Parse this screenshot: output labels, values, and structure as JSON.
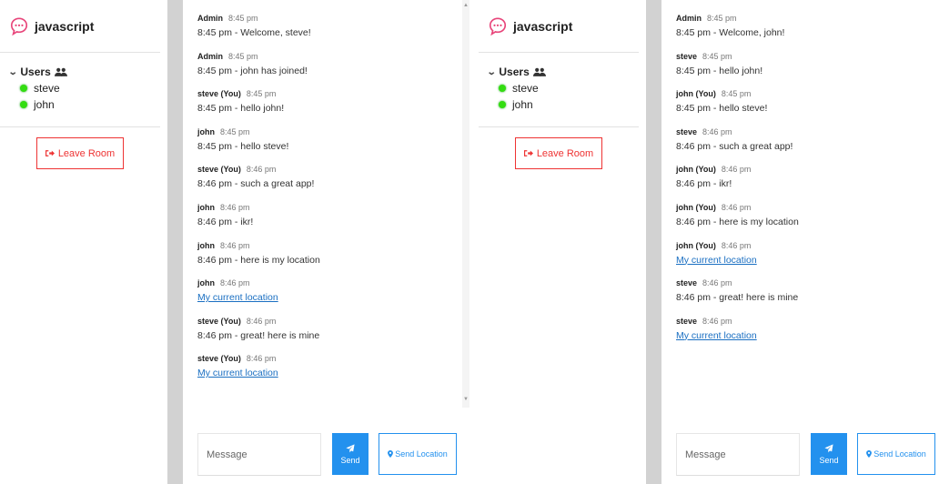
{
  "windows": [
    {
      "room": {
        "name": "javascript"
      },
      "users": {
        "heading": "Users",
        "list": [
          "steve",
          "john"
        ]
      },
      "leave_label": "Leave Room",
      "messages": [
        {
          "author": "Admin",
          "time": "8:45 pm",
          "text": "8:45 pm - Welcome, steve!",
          "is_link": false
        },
        {
          "author": "Admin",
          "time": "8:45 pm",
          "text": "8:45 pm - john has joined!",
          "is_link": false
        },
        {
          "author": "steve (You)",
          "time": "8:45 pm",
          "text": "8:45 pm - hello john!",
          "is_link": false
        },
        {
          "author": "john",
          "time": "8:45 pm",
          "text": "8:45 pm - hello steve!",
          "is_link": false
        },
        {
          "author": "steve (You)",
          "time": "8:46 pm",
          "text": "8:46 pm - such a great app!",
          "is_link": false
        },
        {
          "author": "john",
          "time": "8:46 pm",
          "text": "8:46 pm - ikr!",
          "is_link": false
        },
        {
          "author": "john",
          "time": "8:46 pm",
          "text": "8:46 pm - here is my location",
          "is_link": false
        },
        {
          "author": "john",
          "time": "8:46 pm",
          "text": "My current location",
          "is_link": true
        },
        {
          "author": "steve (You)",
          "time": "8:46 pm",
          "text": "8:46 pm - great! here is mine",
          "is_link": false
        },
        {
          "author": "steve (You)",
          "time": "8:46 pm",
          "text": "My current location",
          "is_link": true
        }
      ],
      "compose": {
        "placeholder": "Message",
        "send_label": "Send",
        "location_label": "Send Location"
      }
    },
    {
      "room": {
        "name": "javascript"
      },
      "users": {
        "heading": "Users",
        "list": [
          "steve",
          "john"
        ]
      },
      "leave_label": "Leave Room",
      "messages": [
        {
          "author": "Admin",
          "time": "8:45 pm",
          "text": "8:45 pm - Welcome, john!",
          "is_link": false
        },
        {
          "author": "steve",
          "time": "8:45 pm",
          "text": "8:45 pm - hello john!",
          "is_link": false
        },
        {
          "author": "john (You)",
          "time": "8:45 pm",
          "text": "8:45 pm - hello steve!",
          "is_link": false
        },
        {
          "author": "steve",
          "time": "8:46 pm",
          "text": "8:46 pm - such a great app!",
          "is_link": false
        },
        {
          "author": "john (You)",
          "time": "8:46 pm",
          "text": "8:46 pm - ikr!",
          "is_link": false
        },
        {
          "author": "john (You)",
          "time": "8:46 pm",
          "text": "8:46 pm - here is my location",
          "is_link": false
        },
        {
          "author": "john (You)",
          "time": "8:46 pm",
          "text": "My current location",
          "is_link": true
        },
        {
          "author": "steve",
          "time": "8:46 pm",
          "text": "8:46 pm - great! here is mine",
          "is_link": false
        },
        {
          "author": "steve",
          "time": "8:46 pm",
          "text": "My current location",
          "is_link": true
        }
      ],
      "compose": {
        "placeholder": "Message",
        "send_label": "Send",
        "location_label": "Send Location"
      }
    }
  ],
  "icons": {
    "room": "chat-bubble-icon",
    "users": "users-group-icon",
    "leave": "sign-out-icon",
    "send": "paper-plane-icon",
    "location": "map-pin-icon",
    "online": "online-dot"
  },
  "colors": {
    "accent": "#2391ee",
    "danger": "#e33333",
    "online": "#33dd11",
    "link": "#1a6fc2",
    "brand_icon": "#e8457a"
  }
}
